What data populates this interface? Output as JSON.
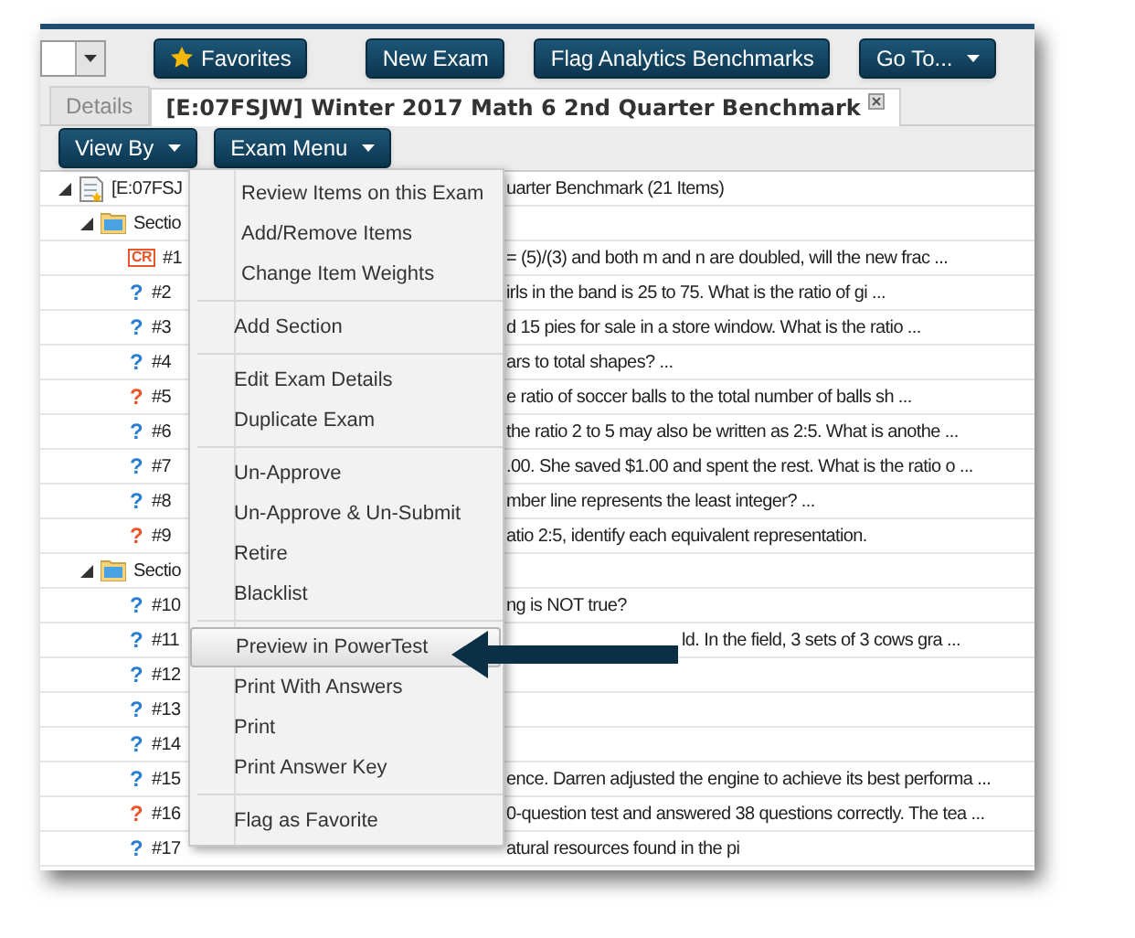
{
  "toolbar": {
    "buttons": [
      {
        "label": "Favorites",
        "kind": "star"
      },
      {
        "label": "New Exam",
        "kind": "plain"
      },
      {
        "label": "Flag Analytics Benchmarks",
        "kind": "plain"
      },
      {
        "label": "Go To...",
        "kind": "dropdown"
      }
    ]
  },
  "tabs": [
    {
      "label": "Details",
      "selected": false,
      "closable": false
    },
    {
      "label": "[E:07FSJW] Winter 2017 Math 6 2nd Quarter Benchmark",
      "selected": true,
      "closable": true
    }
  ],
  "actions": [
    {
      "label": "View By"
    },
    {
      "label": "Exam Menu"
    }
  ],
  "tree": [
    {
      "kind": "exam",
      "lead": "[E:07FSJ",
      "tail": "uarter Benchmark (21 Items)",
      "expanded": true,
      "children": [
        {
          "kind": "section",
          "lead": "Sectio",
          "expanded": true,
          "children": [
            {
              "kind": "item",
              "badge": "CR",
              "color": "#e8562a",
              "lead": "#1",
              "tail": "= (5)/(3) and both m and n are doubled, will the new frac ..."
            },
            {
              "kind": "item",
              "badge": "?",
              "color": "#2a7fd4",
              "lead": "#2",
              "tail": "irls in the band is 25 to 75. What is the ratio of gi ..."
            },
            {
              "kind": "item",
              "badge": "?",
              "color": "#2a7fd4",
              "lead": "#3",
              "tail": "d 15 pies for sale in a store window. What is the ratio ..."
            },
            {
              "kind": "item",
              "badge": "?",
              "color": "#2a7fd4",
              "lead": "#4",
              "tail": "ars to total shapes? ..."
            },
            {
              "kind": "item",
              "badge": "?",
              "color": "#e8562a",
              "lead": "#5",
              "tail": "e ratio of soccer balls to the total number of balls sh ..."
            },
            {
              "kind": "item",
              "badge": "?",
              "color": "#2a7fd4",
              "lead": "#6",
              "tail": "the ratio 2 to 5 may also be written as 2:5. What is anothe ..."
            },
            {
              "kind": "item",
              "badge": "?",
              "color": "#2a7fd4",
              "lead": "#7",
              "tail": ".00. She saved $1.00 and spent the rest. What is the ratio o ..."
            },
            {
              "kind": "item",
              "badge": "?",
              "color": "#2a7fd4",
              "lead": "#8",
              "tail": "mber line represents the least integer? ..."
            },
            {
              "kind": "item",
              "badge": "?",
              "color": "#e8562a",
              "lead": "#9",
              "tail": "atio 2:5, identify each equivalent representation."
            }
          ]
        },
        {
          "kind": "section",
          "lead": "Sectio",
          "expanded": true,
          "children": [
            {
              "kind": "item",
              "badge": "?",
              "color": "#2a7fd4",
              "lead": "#10",
              "tail": "ng is NOT true?"
            },
            {
              "kind": "item",
              "badge": "?",
              "color": "#2a7fd4",
              "lead": "#11",
              "tail": "ld. In the field, 3 sets of 3 cows gra ...",
              "callout": true
            },
            {
              "kind": "item",
              "badge": "?",
              "color": "#2a7fd4",
              "lead": "#12"
            },
            {
              "kind": "item",
              "badge": "?",
              "color": "#2a7fd4",
              "lead": "#13"
            },
            {
              "kind": "item",
              "badge": "?",
              "color": "#2a7fd4",
              "lead": "#14"
            },
            {
              "kind": "item",
              "badge": "?",
              "color": "#2a7fd4",
              "lead": "#15",
              "tail": "ence. Darren adjusted the engine to achieve its best performa ..."
            },
            {
              "kind": "item",
              "badge": "?",
              "color": "#e8562a",
              "lead": "#16",
              "tail": "0-question test and answered 38 questions correctly. The tea ..."
            },
            {
              "kind": "item",
              "badge": "?",
              "color": "#2a7fd4",
              "lead": "#17",
              "tail": "atural resources found in the pi"
            }
          ]
        }
      ]
    }
  ],
  "menu": {
    "groups": [
      [
        {
          "label": "Review Items on this Exam",
          "selected": false
        },
        {
          "label": "Add/Remove Items",
          "selected": false
        },
        {
          "label": "Change Item Weights",
          "selected": false
        }
      ],
      [
        {
          "label": "Add Section",
          "selected": false
        }
      ],
      [
        {
          "label": "Edit Exam Details",
          "selected": false
        },
        {
          "label": "Duplicate Exam",
          "selected": false
        }
      ],
      [
        {
          "label": "Un-Approve",
          "selected": false
        },
        {
          "label": "Un-Approve & Un-Submit",
          "selected": false
        },
        {
          "label": "Retire",
          "selected": false
        },
        {
          "label": "Blacklist",
          "selected": false
        }
      ],
      [
        {
          "label": "Preview in PowerTest",
          "selected": true
        },
        {
          "label": "Print With Answers",
          "selected": false
        },
        {
          "label": "Print",
          "selected": false
        },
        {
          "label": "Print Answer Key",
          "selected": false
        }
      ],
      [
        {
          "label": "Flag as Favorite",
          "selected": false
        }
      ]
    ]
  }
}
